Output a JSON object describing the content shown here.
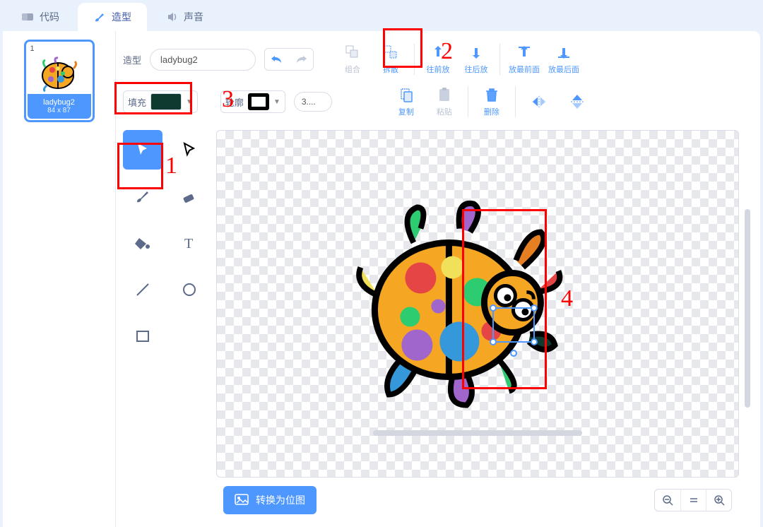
{
  "tabs": {
    "code": "代码",
    "costumes": "造型",
    "sounds": "声音"
  },
  "costume": {
    "index": "1",
    "name": "ladybug2",
    "dimensions": "84 x 87"
  },
  "labels": {
    "costume": "造型",
    "fill": "填充",
    "outline": "轮廓"
  },
  "outline_width": "3....",
  "colors": {
    "fill": "#0f3a2f"
  },
  "row1_actions": {
    "group": "组合",
    "ungroup": "拆散",
    "forward": "往前放",
    "backward": "往后放",
    "front": "放最前面",
    "back": "放最后面"
  },
  "row2_actions": {
    "copy": "复制",
    "paste": "粘贴",
    "delete": "删除"
  },
  "bottom": {
    "convert": "转换为位图"
  },
  "annotations": {
    "n1": "1",
    "n2": "2",
    "n3": "3",
    "n4": "4"
  }
}
